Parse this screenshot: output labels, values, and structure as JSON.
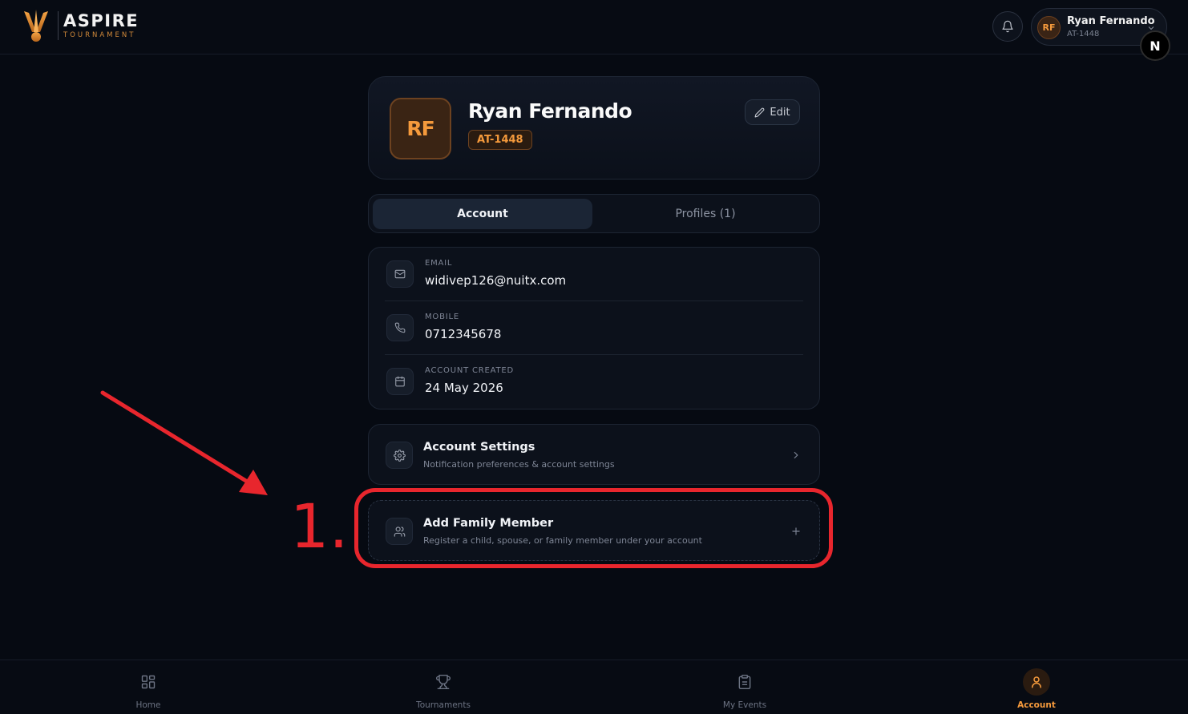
{
  "header": {
    "brand_title": "ASPIRE",
    "brand_subtitle": "TOURNAMENT",
    "user_initials": "RF",
    "user_name": "Ryan Fernando",
    "user_id": "AT-1448",
    "n_badge": "N"
  },
  "profile": {
    "initials": "RF",
    "name": "Ryan Fernando",
    "id": "AT-1448",
    "edit_label": "Edit"
  },
  "tabs": [
    {
      "label": "Account",
      "active": true
    },
    {
      "label": "Profiles (1)",
      "active": false
    }
  ],
  "info": [
    {
      "label": "EMAIL",
      "value": "widivep126@nuitx.com",
      "icon": "mail-icon"
    },
    {
      "label": "MOBILE",
      "value": "0712345678",
      "icon": "phone-icon"
    },
    {
      "label": "ACCOUNT CREATED",
      "value": "24 May 2026",
      "icon": "calendar-icon"
    }
  ],
  "settings": {
    "title": "Account Settings",
    "subtitle": "Notification preferences & account settings"
  },
  "family": {
    "title": "Add Family Member",
    "subtitle": "Register a child, spouse, or family member under your account"
  },
  "annotation": {
    "step": "1.",
    "color": "#e8262d"
  },
  "nav": [
    {
      "label": "Home",
      "icon": "grid-icon",
      "active": false
    },
    {
      "label": "Tournaments",
      "icon": "trophy-icon",
      "active": false
    },
    {
      "label": "My Events",
      "icon": "clipboard-icon",
      "active": false
    },
    {
      "label": "Account",
      "icon": "user-icon",
      "active": true
    }
  ],
  "colors": {
    "accent": "#f59a3c",
    "background": "#060a12",
    "card": "#0c111b"
  }
}
